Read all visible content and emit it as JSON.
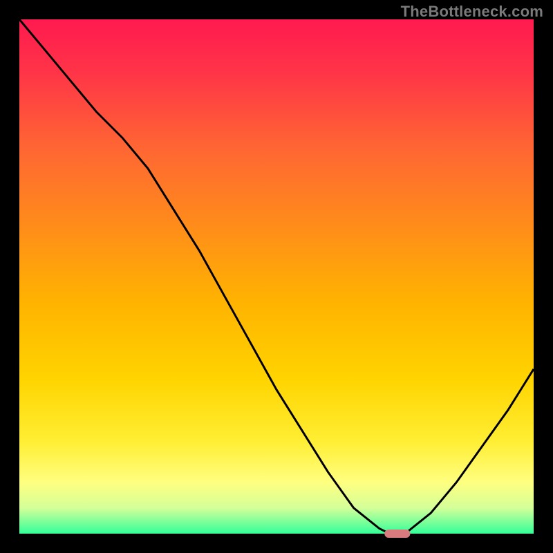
{
  "watermark": "TheBottleneck.com",
  "chart_data": {
    "type": "line",
    "title": "",
    "xlabel": "",
    "ylabel": "",
    "xlim": [
      0,
      100
    ],
    "ylim": [
      0,
      100
    ],
    "x": [
      0,
      5,
      10,
      15,
      20,
      25,
      30,
      35,
      40,
      45,
      50,
      55,
      60,
      65,
      70,
      72,
      75,
      80,
      85,
      90,
      95,
      100
    ],
    "values": [
      100,
      94,
      88,
      82,
      77,
      71,
      63,
      55,
      46,
      37,
      28,
      20,
      12,
      5,
      1,
      0,
      0,
      4,
      10,
      17,
      24,
      32
    ],
    "flat_region": {
      "x_start": 70,
      "x_end": 76,
      "y": 0
    },
    "marker": {
      "x_start": 71,
      "x_end": 76,
      "y": 0,
      "color": "#d97a7e"
    },
    "gradient_stops": [
      {
        "offset": 0.0,
        "color": "#ff1a4f"
      },
      {
        "offset": 0.1,
        "color": "#ff3348"
      },
      {
        "offset": 0.25,
        "color": "#ff6633"
      },
      {
        "offset": 0.4,
        "color": "#ff8c1a"
      },
      {
        "offset": 0.55,
        "color": "#ffb300"
      },
      {
        "offset": 0.7,
        "color": "#ffd400"
      },
      {
        "offset": 0.82,
        "color": "#ffee33"
      },
      {
        "offset": 0.9,
        "color": "#ffff80"
      },
      {
        "offset": 0.95,
        "color": "#d4ff99"
      },
      {
        "offset": 1.0,
        "color": "#33ff99"
      }
    ],
    "background_color": "#000000",
    "line_color": "#000000"
  }
}
